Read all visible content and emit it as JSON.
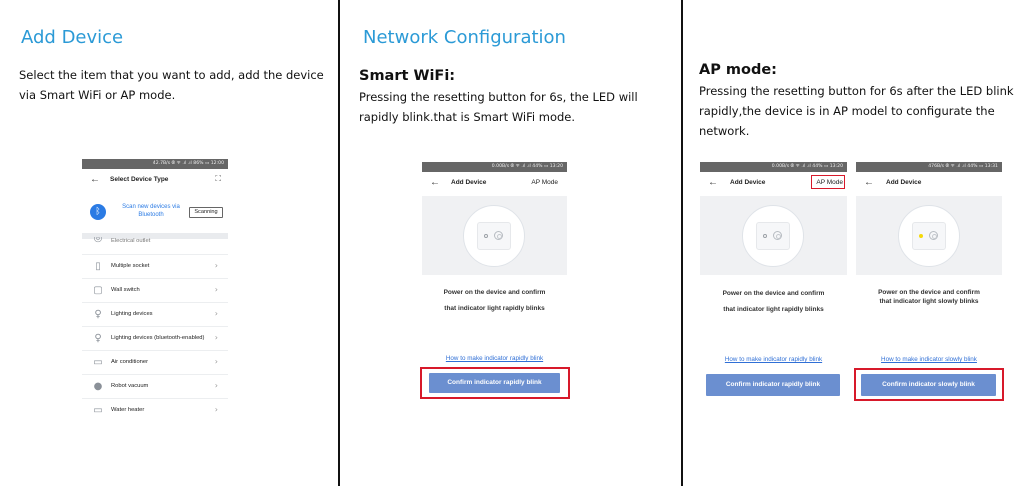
{
  "panel1": {
    "title": "Add Device",
    "desc": "Select the item that  you want to add, add the device via Smart WiFi or AP mode.",
    "phone": {
      "status": "42.7B/s  ⦾ ᯤ .ıl .ıl 86%  ▭  12:00",
      "header_title": "Select Device Type",
      "scan_text": "Scan new devices via Bluetooth",
      "scan_button": "Scanning",
      "items": [
        {
          "label": "Electrical outlet",
          "icon": "outlet-icon"
        },
        {
          "label": "Multiple socket",
          "icon": "power-strip-icon"
        },
        {
          "label": "Wall switch",
          "icon": "wall-switch-icon"
        },
        {
          "label": "Lighting devices",
          "icon": "bulb-icon"
        },
        {
          "label": "Lighting devices (bluetooth-enabled)",
          "icon": "bulb-icon"
        },
        {
          "label": "Air conditioner",
          "icon": "air-conditioner-icon"
        },
        {
          "label": "Robot vacuum",
          "icon": "robot-vacuum-icon"
        },
        {
          "label": "Water heater",
          "icon": "water-heater-icon"
        }
      ]
    }
  },
  "panel2": {
    "title": "Network Configuration",
    "subhead": "Smart WiFi:",
    "desc": "Pressing the resetting button for 6s, the LED will rapidly blink.that is Smart WiFi mode.",
    "phone": {
      "status": "0.00B/s  ⦾ ᯤ .ıl .ıl 44%  ▭  13:20",
      "header_title": "Add Device",
      "header_right": "AP Mode",
      "message_line1": "Power on the device and confirm",
      "message_line2": "that indicator light rapidly blinks",
      "link": "How to make indicator rapidly blink",
      "button": "Confirm indicator rapidly blink"
    }
  },
  "panel3": {
    "subhead": "AP mode:",
    "desc": "Pressing the resetting button for 6s after the LED blink rapidly,the device is in AP model to configurate the network.",
    "phoneA": {
      "status": "0.00B/s  ⦾ ᯤ .ıl .ıl 44%  ▭  13:20",
      "header_title": "Add Device",
      "header_right": "AP Mode",
      "message_line1": "Power on the device and confirm",
      "message_line2": "that indicator light rapidly blinks",
      "link": "How to make indicator rapidly blink",
      "button": "Confirm indicator rapidly blink"
    },
    "phoneB": {
      "status": "476B/s  ⦾ ᯤ .ıl .ıl 44%  ▭  13:31",
      "header_title": "Add Device",
      "message_line1": "Power on the device and confirm",
      "message_line2": "that indicator light slowly blinks",
      "link": "How to make indicator slowly blink",
      "button": "Confirm indicator slowly blink"
    }
  },
  "colors": {
    "title_blue": "#2b9ad6",
    "button_blue": "#6b8fd0",
    "highlight_red": "#d7192a",
    "led_yellow": "#f5d90a"
  }
}
